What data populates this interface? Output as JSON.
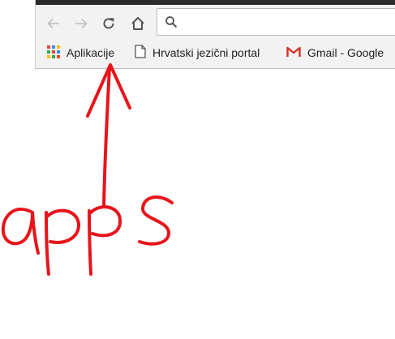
{
  "toolbar": {
    "back_icon": "arrow-left-icon",
    "forward_icon": "arrow-right-icon",
    "reload_icon": "reload-icon",
    "home_icon": "home-icon"
  },
  "omnibox": {
    "value": "",
    "icon": "search-icon"
  },
  "bookmarks": [
    {
      "label": "Aplikacije",
      "icon": "apps-grid-icon"
    },
    {
      "label": "Hrvatski jezični portal",
      "icon": "page-icon"
    },
    {
      "label": "Gmail - Google",
      "icon": "gmail-icon"
    }
  ],
  "annotation": {
    "text": "apps",
    "color": "#e8141b"
  },
  "colors": {
    "chrome_bg": "#f2f2f2",
    "gmail_red": "#d93025"
  }
}
